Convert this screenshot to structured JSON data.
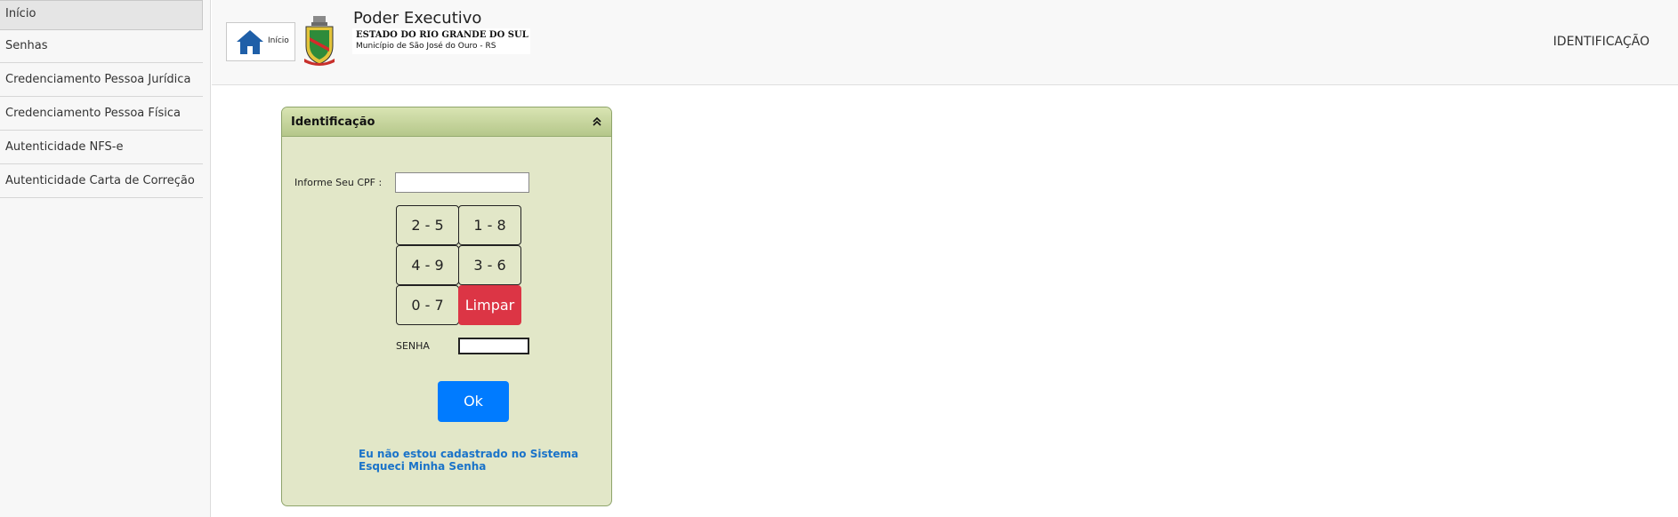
{
  "sidebar": {
    "items": [
      {
        "label": "Início"
      },
      {
        "label": "Senhas"
      },
      {
        "label": "Credenciamento Pessoa Jurídica"
      },
      {
        "label": "Credenciamento Pessoa Física"
      },
      {
        "label": "Autenticidade NFS-e"
      },
      {
        "label": "Autenticidade Carta de Correção"
      }
    ]
  },
  "header": {
    "home_label": "Início",
    "title": "Poder Executivo",
    "state": "ESTADO DO RIO GRANDE DO SUL",
    "city": "Município de São José do Ouro - RS",
    "right_link": "IDENTIFICAÇÃO"
  },
  "panel": {
    "title": "Identificação",
    "cpf_label": "Informe Seu CPF :",
    "cpf_value": "",
    "keys": [
      "2 - 5",
      "1 - 8",
      "4 - 9",
      "3 - 6",
      "0 - 7"
    ],
    "clear_label": "Limpar",
    "senha_label": "SENHA",
    "senha_value": "",
    "ok_label": "Ok",
    "link_not_registered": "Eu não estou cadastrado no Sistema",
    "link_forgot": "Esqueci Minha Senha"
  },
  "colors": {
    "panel_bg": "#e2e7c8",
    "panel_header": "#b5c78a",
    "clear_button": "#dc3545",
    "ok_button": "#007bff",
    "link": "#1a73c9",
    "home_icon": "#1f5fa8"
  },
  "icons": {
    "home": "home-icon",
    "collapse": "double-chevron-up-icon",
    "crest": "municipal-crest-icon"
  }
}
